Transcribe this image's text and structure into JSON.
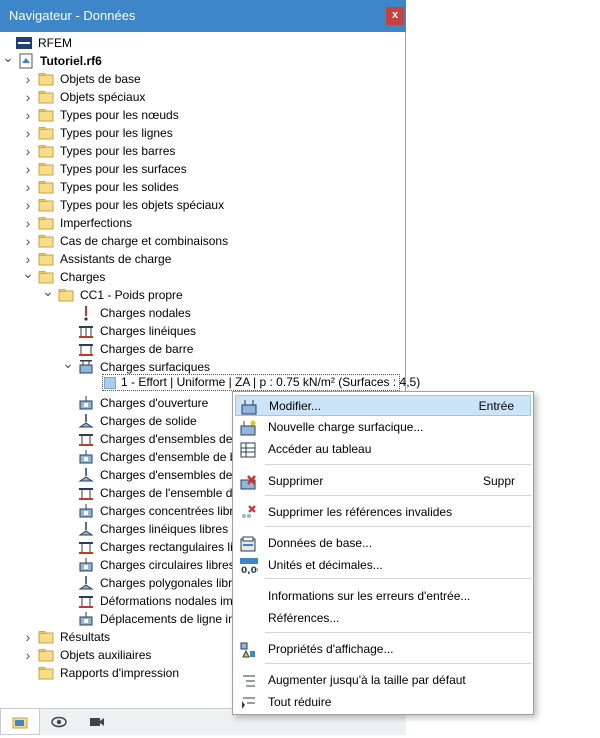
{
  "window": {
    "title": "Navigateur - Données",
    "close": "x"
  },
  "tree": {
    "root": "RFEM",
    "file": "Tutoriel.rf6",
    "folders": [
      "Objets de base",
      "Objets spéciaux",
      "Types pour les nœuds",
      "Types pour les lignes",
      "Types pour les barres",
      "Types pour les surfaces",
      "Types pour les solides",
      "Types pour les objets spéciaux",
      "Imperfections",
      "Cas de charge et combinaisons",
      "Assistants de charge",
      "Charges"
    ],
    "load_case": "CC1 - Poids propre",
    "load_items_top": [
      "Charges nodales",
      "Charges linéiques",
      "Charges de barre",
      "Charges surfaciques"
    ],
    "selected_item": "1 - Effort | Uniforme | ZA | p : 0.75 kN/m² (Surfaces : 4,5)",
    "load_items_bottom": [
      "Charges d'ouverture",
      "Charges de solide",
      "Charges d'ensembles de",
      "Charges d'ensemble de b",
      "Charges d'ensembles de",
      "Charges de l'ensemble d",
      "Charges concentrées libr",
      "Charges linéiques libres",
      "Charges rectangulaires li",
      "Charges circulaires libres",
      "Charges polygonales libr",
      "Déformations nodales im",
      "Déplacements de ligne im"
    ],
    "bottom_folders": [
      "Résultats",
      "Objets auxiliaires",
      "Rapports d'impression"
    ]
  },
  "context_menu": {
    "items": [
      {
        "label": "Modifier...",
        "shortcut": "Entrée",
        "icon": "edit-icon"
      },
      {
        "label": "Nouvelle charge surfacique...",
        "shortcut": "",
        "icon": "new-surface-load-icon"
      },
      {
        "label": "Accéder au tableau",
        "shortcut": "",
        "icon": "table-icon"
      },
      {
        "label": "Supprimer",
        "shortcut": "Suppr",
        "icon": "delete-icon"
      },
      {
        "label": "Supprimer les références invalides",
        "shortcut": "",
        "icon": "delete-references-icon"
      },
      {
        "label": "Données de base...",
        "shortcut": "",
        "icon": "base-data-icon"
      },
      {
        "label": "Unités et décimales...",
        "shortcut": "",
        "icon": "units-icon"
      },
      {
        "label": "Informations sur les erreurs d'entrée...",
        "shortcut": "",
        "icon": ""
      },
      {
        "label": "Références...",
        "shortcut": "",
        "icon": ""
      },
      {
        "label": "Propriétés d'affichage...",
        "shortcut": "",
        "icon": "display-properties-icon"
      },
      {
        "label": "Augmenter jusqu'à la taille par défaut",
        "shortcut": "",
        "icon": "expand-icon"
      },
      {
        "label": "Tout réduire",
        "shortcut": "",
        "icon": "collapse-icon"
      }
    ],
    "units_icon_text": "0,00"
  },
  "colors": {
    "titlebar": "#3d86c7",
    "close": "#c94040",
    "highlight": "#cce4f7",
    "folder": "#f8dd87"
  }
}
